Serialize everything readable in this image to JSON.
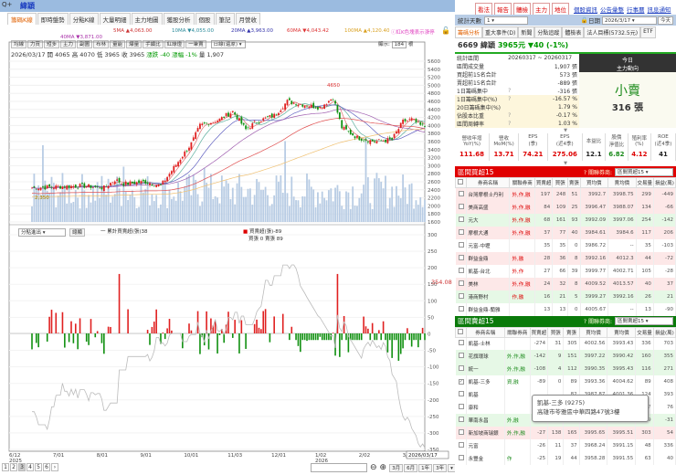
{
  "app": {
    "title": "緯穎",
    "menu_arrow": "▾",
    "search": "Q+"
  },
  "top_buttons": [
    "看法",
    "報告",
    "體檢",
    "主力",
    "地位"
  ],
  "top_links": [
    "個股資訊",
    "公告彙整",
    "行事曆",
    "訊息通知"
  ],
  "tabs": [
    "籌碼K線",
    "即時盤勢",
    "分點K線",
    "大量明細",
    "主力地圖",
    "獲股分析",
    "個股",
    "筆記",
    "月營收"
  ],
  "ma": {
    "ma5": "5MA ▲4,063.00",
    "ma10": "10MA ▼4,055.00",
    "ma20": "20MA ▲3,963.00",
    "ma60": "60MA ▼4,043.42",
    "ma100": "100MA ▲4,120.40",
    "ma40": "40MA ▼3,871.00",
    "note": "ⓘ紅K色塊表示漲停"
  },
  "toolbar": {
    "buttons": [
      "均線",
      "力買",
      "短多",
      "主力",
      "副圖",
      "布林",
      "量能",
      "爆量",
      "手續比",
      "紅綠燈",
      "一筆賣"
    ],
    "period": "日線(還原) ▾",
    "show_label": "顯示:",
    "show_count": "184",
    "show_unit": "根"
  },
  "quote": {
    "date": "2026/03/17",
    "open": "開 4065",
    "high": "高 4070",
    "low": "低 3965",
    "close": "收 3965",
    "chg": "漲跌 -40",
    "pct": "漲幅 -1%",
    "vol": "量 1,907"
  },
  "chart": {
    "price_ticks": [
      "5600",
      "5400",
      "5200",
      "5000",
      "4800",
      "4600",
      "4400",
      "4200",
      "4000",
      "3800",
      "3600",
      "3400",
      "3200",
      "3000",
      "2800",
      "2600",
      "2400",
      "2200",
      "2000",
      "1800",
      "1600"
    ],
    "peak_label": "4650",
    "low_label": "2,350",
    "price_path": [
      [
        0,
        2450
      ],
      [
        23,
        2500
      ],
      [
        33,
        2450
      ],
      [
        38,
        2650
      ],
      [
        42,
        2550
      ],
      [
        52,
        2600
      ],
      [
        59,
        2500
      ],
      [
        69,
        3250
      ],
      [
        73,
        3550
      ],
      [
        77,
        4000
      ],
      [
        86,
        4150
      ],
      [
        92,
        4350
      ],
      [
        98,
        3900
      ],
      [
        103,
        4100
      ],
      [
        111,
        4250
      ],
      [
        117,
        4600
      ],
      [
        126,
        4500
      ],
      [
        132,
        4450
      ],
      [
        138,
        4700
      ],
      [
        142,
        3950
      ],
      [
        149,
        3700
      ],
      [
        157,
        3600
      ],
      [
        165,
        3650
      ],
      [
        170,
        4100
      ],
      [
        174,
        4150
      ],
      [
        178,
        4000
      ],
      [
        180,
        3965
      ]
    ],
    "lower_select": "分點進出 ▾",
    "lower_button": "總顯",
    "lower_legend_cum": "一 累計買賣超(張)38",
    "lower_legend_net": "買賣超(張)-89",
    "lower_legend_bs": "買張 0 賣張 89",
    "lower_ticks": [
      "300",
      "250",
      "200",
      "150",
      "100",
      "50",
      "0",
      "-50",
      "-100",
      "-150",
      "-200",
      "-250",
      "-300",
      "-350"
    ],
    "cum_label": "354.08",
    "x_ticks": [
      "6/12",
      "7/01",
      "8/01",
      "9/01",
      "10/01",
      "11/03",
      "12/01",
      "1/02",
      "2/02",
      "3/02"
    ],
    "x_years": [
      "2025",
      "2026"
    ],
    "x_current": "2026/03/17"
  },
  "pager": [
    "1",
    "2",
    "3",
    "4",
    "5",
    "6",
    "›"
  ],
  "zoom_ctrl": {
    "periods": [
      "3月",
      "6月",
      "1年",
      "3年"
    ],
    "more": "▾",
    "reset": "還原"
  },
  "right": {
    "days_label": "統計天數",
    "days_value": "1 ▾",
    "date_label": "日期",
    "date_value": "2026/3/17 ▾",
    "today": "今天",
    "tabs": [
      "籌碼分析",
      "重大事件(D)",
      "新聞",
      "分點追蹤",
      "體檢表",
      "法人目標(5732.5元)",
      "ETF"
    ],
    "stock": {
      "code_name": "6669 緯穎",
      "price": "3965元",
      "change": "▼40 (-1%)"
    },
    "stats": [
      [
        "統計區間",
        "20260317 ~ 20260317",
        ""
      ],
      [
        "區間成交量",
        "",
        "1,907 張"
      ],
      [
        "買超前15名合計",
        "",
        "573 張"
      ],
      [
        "賣超前15名合計",
        "",
        "-889 張"
      ],
      [
        "1日籌碼集中",
        "?",
        "-316 張"
      ],
      [
        "1日籌碼集中(%)",
        "?",
        "-16.57 %"
      ],
      [
        "20日籌碼集中(%)",
        "",
        "1.79 %"
      ],
      [
        "佔股本比重",
        "?",
        "-0.17 %"
      ],
      [
        "區間周轉率",
        "?",
        "1.03 %"
      ]
    ],
    "main_force": {
      "title1": "今日",
      "title2": "主力動向",
      "label": "小賣",
      "amount": "316 張"
    },
    "metrics": {
      "headers": [
        "營收年增\nYoY(%)",
        "營收\nMoM(%)",
        "EPS\n(季)",
        "EPS\n(近4季)",
        "本益比",
        "股價\n淨值比",
        "殖利率\n(%)",
        "ROE\n(近4季)"
      ],
      "values": [
        "111.68",
        "13.71",
        "74.21",
        "275.06",
        "12.1",
        "6.82",
        "4.12",
        "41"
      ]
    },
    "buy": {
      "title": "區間買超15",
      "rel_label": "? 關聯券商:",
      "rel_value": "區間買超15 ▾",
      "headers": [
        "券商名稱",
        "關聯券商",
        "買賣超",
        "買張",
        "賣張",
        "買均價",
        "賣均價",
        "交易量",
        "損益(萬)"
      ],
      "rows": [
        [
          "台灣摩根士丹利",
          "外,作,融",
          "197",
          "248",
          "51",
          "3992.7",
          "3998.75",
          "299",
          "-449"
        ],
        [
          "美商高盛",
          "外,作,融",
          "84",
          "109",
          "25",
          "3996.47",
          "3988.07",
          "134",
          "-66"
        ],
        [
          "元大",
          "外,作,融",
          "68",
          "161",
          "93",
          "3992.09",
          "3997.06",
          "254",
          "-142"
        ],
        [
          "摩根大通",
          "外,作,融",
          "37",
          "77",
          "40",
          "3984.61",
          "3984.6",
          "117",
          "206"
        ],
        [
          "元富-中壢",
          "",
          "35",
          "35",
          "0",
          "3986.72",
          "--",
          "35",
          "-103"
        ],
        [
          "群益金鼎",
          "外,融",
          "28",
          "36",
          "8",
          "3992.16",
          "4012.3",
          "44",
          "-72"
        ],
        [
          "凱基-台北",
          "外,作",
          "27",
          "66",
          "39",
          "3999.77",
          "4002.71",
          "105",
          "-28"
        ],
        [
          "美林",
          "外,作,融",
          "24",
          "32",
          "8",
          "4009.52",
          "4013.57",
          "40",
          "37"
        ],
        [
          "港商野村",
          "作,融",
          "16",
          "21",
          "5",
          "3999.27",
          "3992.16",
          "26",
          "21"
        ],
        [
          "群益金鼎-蘭雅",
          "",
          "13",
          "13",
          "0",
          "4005.67",
          "--",
          "13",
          "-90"
        ]
      ],
      "shade": [
        "pink",
        "pink",
        "grn",
        "pink",
        "",
        "pink",
        "",
        "pink",
        "grn",
        ""
      ]
    },
    "sell": {
      "title": "區間賣超15",
      "rel_label": "? 關聯券商:",
      "rel_value": "區間賣超15 ▾",
      "headers": [
        "券商名稱",
        "關聯券商",
        "買賣超",
        "買張",
        "賣張",
        "買均價",
        "賣均價",
        "交易量",
        "損益(萬)"
      ],
      "rows": [
        [
          "凱基-士林",
          "",
          "-274",
          "31",
          "305",
          "4002.56",
          "3993.43",
          "336",
          "703"
        ],
        [
          "花旗環球",
          "外,作,融",
          "-142",
          "9",
          "151",
          "3997.22",
          "3990.42",
          "160",
          "355"
        ],
        [
          "統一",
          "外,作,融",
          "-108",
          "4",
          "112",
          "3990.35",
          "3995.43",
          "116",
          "271"
        ],
        [
          "凱基-三多",
          "資,融",
          "-89",
          "0",
          "89",
          "3993.36",
          "4004.62",
          "89",
          "408"
        ],
        [
          "凱基",
          "",
          "",
          "",
          "82",
          "3987.87",
          "4001.36",
          "124",
          "393"
        ],
        [
          "康和",
          "",
          "",
          "",
          "37",
          "3990",
          "3990.54",
          "37",
          "76"
        ],
        [
          "華南永昌",
          "外,融",
          "-31",
          "4",
          "35",
          "3984.50",
          "3993.68",
          "39",
          "-31"
        ],
        [
          "新加坡商瑞銀",
          "外,作,融",
          "-27",
          "138",
          "165",
          "3995.65",
          "3995.51",
          "303",
          "54"
        ],
        [
          "元富",
          "",
          "-26",
          "11",
          "37",
          "3968.24",
          "3991.15",
          "48",
          "336"
        ],
        [
          "永豐金",
          "作",
          "-25",
          "19",
          "44",
          "3958.28",
          "3991.55",
          "63",
          "40"
        ]
      ],
      "shade": [
        "",
        "grn",
        "grn",
        "",
        "",
        "",
        "grn",
        "pink",
        "",
        ""
      ],
      "checked": 3
    },
    "tooltip": {
      "name": "凱基-三多 (9275)",
      "address": "高雄市苓雅區中華四路47號3樓"
    }
  },
  "colors": {
    "up": "#e02020",
    "down": "#109010",
    "vol": "#b8cce4",
    "buy_header": "#e00000",
    "sell_header": "#0a7a0a"
  }
}
